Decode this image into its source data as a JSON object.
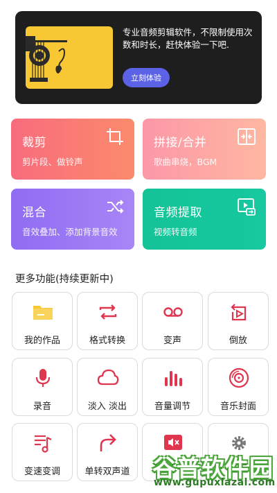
{
  "promo": {
    "text": "专业音频剪辑软件，不限制使用次数和时长，赶快体验一下吧.",
    "button": "立刻体验"
  },
  "cards": {
    "trim": {
      "title": "裁剪",
      "subtitle": "剪片段、做铃声"
    },
    "join": {
      "title": "拼接/合并",
      "subtitle": "歌曲串烧，BGM"
    },
    "mix": {
      "title": "混合",
      "subtitle": "音效叠加、添加背景音效"
    },
    "extract": {
      "title": "音频提取",
      "subtitle": "视频转音频"
    }
  },
  "more": {
    "title": "更多功能(持续更新中)",
    "items": [
      {
        "label": "我的作品",
        "icon": "folder-icon"
      },
      {
        "label": "格式转换",
        "icon": "convert-icon"
      },
      {
        "label": "变声",
        "icon": "voicemail-icon"
      },
      {
        "label": "倒放",
        "icon": "reverse-icon"
      },
      {
        "label": "录音",
        "icon": "microphone-icon"
      },
      {
        "label": "淡入 淡出",
        "icon": "cloud-icon"
      },
      {
        "label": "音量调节",
        "icon": "volume-bars-icon"
      },
      {
        "label": "音乐封面",
        "icon": "disc-icon"
      },
      {
        "label": "变速变调",
        "icon": "music-note-list-icon"
      },
      {
        "label": "单转双声道",
        "icon": "redo-arrow-icon"
      },
      {
        "label": "",
        "icon": "mute-icon"
      },
      {
        "label": "",
        "icon": "gear-icon"
      }
    ]
  },
  "watermark": {
    "cn": "谷普软件园",
    "url": "www.gupuxlazal.com"
  },
  "colors": {
    "accent": "#e0354e",
    "button": "#5b62e6",
    "folder": "#f7c734"
  }
}
